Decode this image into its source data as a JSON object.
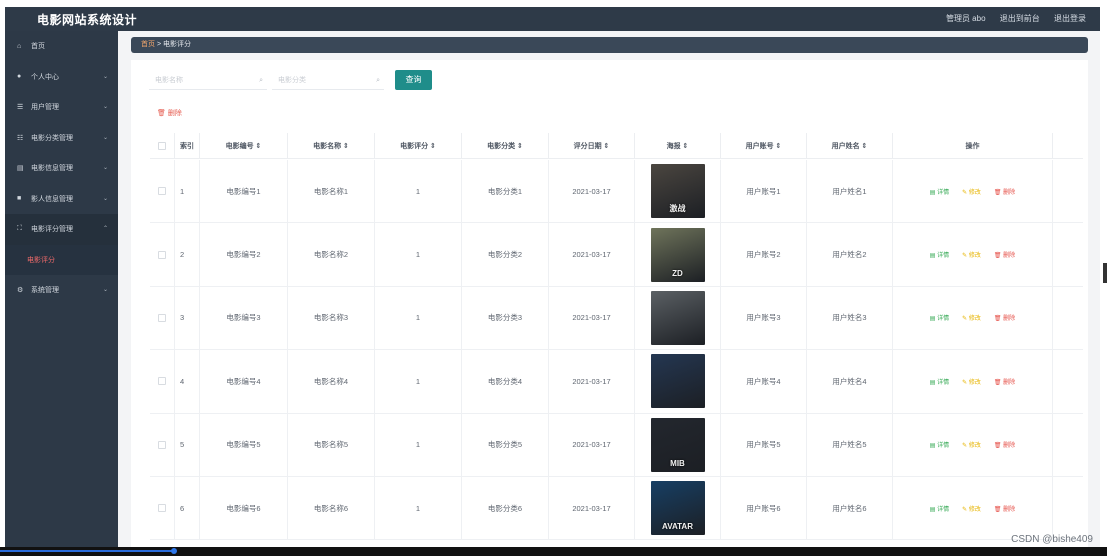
{
  "topbar": {
    "title": "电影网站系统设计",
    "admin_label": "管理员 abo",
    "back_label": "退出到前台",
    "logout_label": "退出登录"
  },
  "sidebar": {
    "items": [
      {
        "icon": "home-icon",
        "label": "首页"
      },
      {
        "icon": "person-icon",
        "label": "个人中心"
      },
      {
        "icon": "list-icon",
        "label": "用户管理"
      },
      {
        "icon": "sliders-icon",
        "label": "电影分类管理"
      },
      {
        "icon": "film-icon",
        "label": "电影信息管理"
      },
      {
        "icon": "chat-icon",
        "label": "影人信息管理"
      },
      {
        "icon": "expand-icon",
        "label": "电影评分管理"
      },
      {
        "icon": "settings-icon",
        "label": "系统管理"
      }
    ],
    "sub_item": "电影评分"
  },
  "breadcrumb": {
    "home": "首页",
    "separator": ">",
    "current": "电影评分"
  },
  "search": {
    "name_placeholder": "电影名称",
    "category_placeholder": "电影分类",
    "query_label": "查询",
    "delete_label": "删除"
  },
  "table": {
    "headers": [
      "索引",
      "电影编号",
      "电影名称",
      "电影评分",
      "电影分类",
      "评分日期",
      "海报",
      "用户账号",
      "用户姓名",
      "操作"
    ],
    "rows": [
      {
        "index": "1",
        "code": "电影编号1",
        "name": "电影名称1",
        "score": "1",
        "category": "电影分类1",
        "date": "2021-03-17",
        "account": "用户账号1",
        "username": "用户姓名1",
        "poster_text": "激战",
        "poster_color": "#4b4640"
      },
      {
        "index": "2",
        "code": "电影编号2",
        "name": "电影名称2",
        "score": "1",
        "category": "电影分类2",
        "date": "2021-03-17",
        "account": "用户账号2",
        "username": "用户姓名2",
        "poster_text": "ZD",
        "poster_color": "#6f745b"
      },
      {
        "index": "3",
        "code": "电影编号3",
        "name": "电影名称3",
        "score": "1",
        "category": "电影分类3",
        "date": "2021-03-17",
        "account": "用户账号3",
        "username": "用户姓名3",
        "poster_text": "",
        "poster_color": "#5b6064"
      },
      {
        "index": "4",
        "code": "电影编号4",
        "name": "电影名称4",
        "score": "1",
        "category": "电影分类4",
        "date": "2021-03-17",
        "account": "用户账号4",
        "username": "用户姓名4",
        "poster_text": "",
        "poster_color": "#243752"
      },
      {
        "index": "5",
        "code": "电影编号5",
        "name": "电影名称5",
        "score": "1",
        "category": "电影分类5",
        "date": "2021-03-17",
        "account": "用户账号5",
        "username": "用户姓名5",
        "poster_text": "MIB",
        "poster_color": "#23272e"
      },
      {
        "index": "6",
        "code": "电影编号6",
        "name": "电影名称6",
        "score": "1",
        "category": "电影分类6",
        "date": "2021-03-17",
        "account": "用户账号6",
        "username": "用户姓名6",
        "poster_text": "AVATAR",
        "poster_color": "#173f64"
      }
    ],
    "op_labels": {
      "detail": "详情",
      "edit": "修改",
      "remove": "删除"
    }
  },
  "watermark": "CSDN @bishe409"
}
